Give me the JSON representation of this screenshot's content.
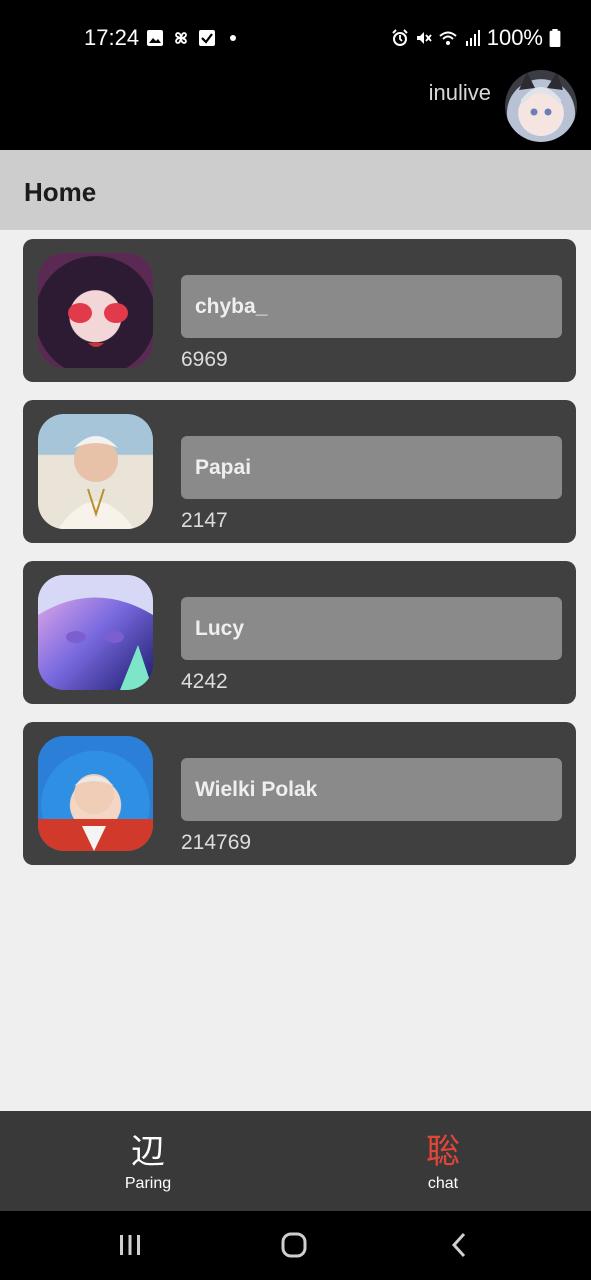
{
  "status_bar": {
    "time": "17:24",
    "battery": "100%"
  },
  "app_bar": {
    "username": "inulive"
  },
  "header": {
    "title": "Home"
  },
  "cards": [
    {
      "name": "chyba_",
      "score": "6969"
    },
    {
      "name": "Papai",
      "score": "2147"
    },
    {
      "name": "Lucy",
      "score": "4242"
    },
    {
      "name": "Wielki Polak",
      "score": "214769"
    }
  ],
  "bottom_nav": {
    "items": [
      {
        "icon": "辺",
        "label": "Paring",
        "color": "#ffffff"
      },
      {
        "icon": "聡",
        "label": "chat",
        "color": "#e2463a"
      }
    ]
  },
  "colors": {
    "active": "#e2463a",
    "card_bg": "#404040",
    "name_bg": "#8a8a8a"
  }
}
